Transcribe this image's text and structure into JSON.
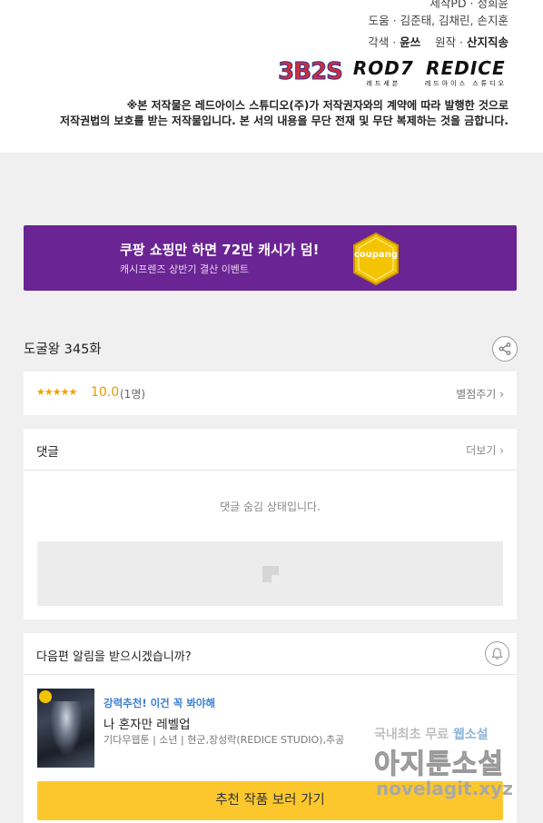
{
  "credits": {
    "line1": "제작PD · 정희윤",
    "line2": "도움 · 김준태, 김채린, 손지훈",
    "line3_label1": "각색 · ",
    "line3_value1": "윤쓰",
    "line3_label2": "원작 · ",
    "line3_value2": "산지직송",
    "logos": [
      {
        "text": "3B2S",
        "sub": ""
      },
      {
        "text": "ROD7",
        "sub": "레드세븐"
      },
      {
        "text": "REDICE",
        "sub": "레드아이스 스튜디오"
      }
    ],
    "notice_line1": "※본 저작물은 레드아이스 스튜디오(주)가 저작권자와의 계약에 따라 발행한 것으로",
    "notice_line2": "저작권법의 보호를 받는 저작물입니다. 본 서의 내용을 무단 전재 및 무단 복제하는 것을 금합니다."
  },
  "banner": {
    "title": "쿠팡 쇼핑만 하면 72만 캐시가 덤!",
    "subtitle": "캐시프렌즈 상반기 결산 이벤트",
    "badge_text": "coupang",
    "bg_color": "#6a2493",
    "badge_color": "#f5c400"
  },
  "episode": {
    "title": "도굴왕 345화",
    "share_icon": "share-icon"
  },
  "rating": {
    "stars": "★★★★★",
    "score": "10.0",
    "count": "(1명)",
    "rate_button": "별점주기"
  },
  "comments": {
    "title": "댓글",
    "more": "더보기",
    "hidden_message": "댓글 숨김 상태입니다."
  },
  "notify": {
    "question": "다음편 알림을 받으시겠습니까?",
    "bell_icon": "bell-icon",
    "rec_label": "강력추천! 이건 꼭 봐야해",
    "rec_title": "나 혼자만 레벨업",
    "rec_meta": "기다무웹툰 | 소년 | 현군,장성락(REDICE STUDIO),추공",
    "rec_button": "추천 작품 보러 가기",
    "button_color": "#fbc72c",
    "label_color": "#3a7fd5"
  },
  "watermark": {
    "line1a": "국내최초 무료 ",
    "line1b": "웹소설",
    "line2": "아지툰소설",
    "line3": "novelagit.xyz"
  }
}
